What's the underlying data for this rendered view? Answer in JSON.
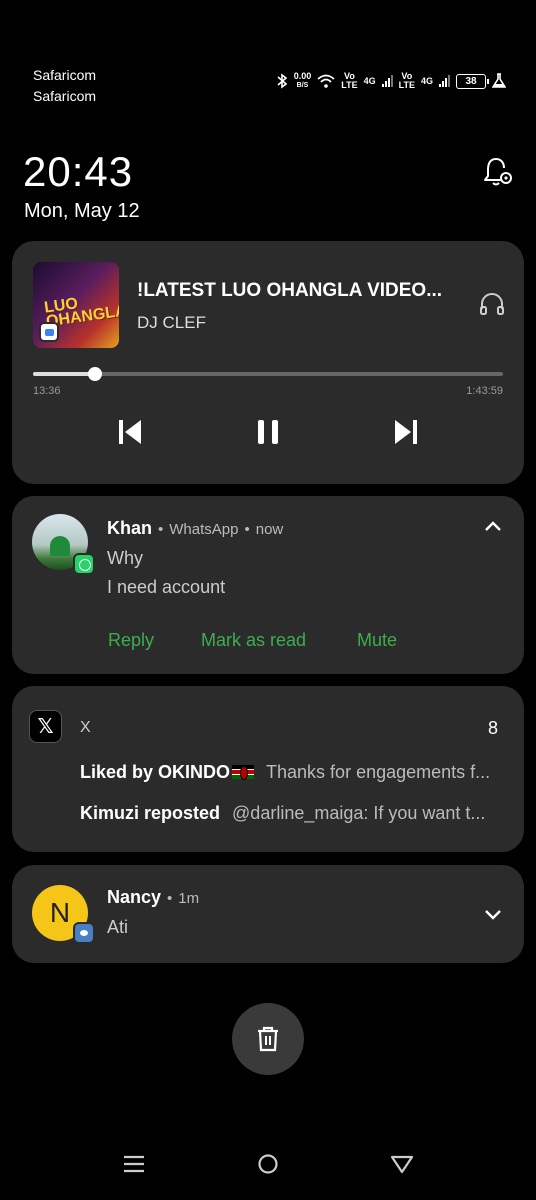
{
  "status_bar": {
    "carrier_1": "Safaricom",
    "carrier_2": "Safaricom",
    "net_speed_value": "0.00",
    "net_speed_unit": "B/S",
    "volte_1": "Vo LTE",
    "net_1": "4G",
    "volte_2": "Vo LTE",
    "net_2": "4G",
    "battery": "38",
    "icons": [
      "bluetooth-icon",
      "wifi-icon",
      "signal-icon",
      "battery-icon",
      "flask-icon"
    ]
  },
  "lock": {
    "time": "20:43",
    "date": "Mon, May 12"
  },
  "media": {
    "title": "!LATEST LUO OHANGLA VIDEO...",
    "artist": "DJ CLEF",
    "album_text_1": "LUO",
    "album_text_2": "OHANGLA",
    "elapsed": "13:36",
    "total": "1:43:59",
    "progress": 0.131
  },
  "whatsapp": {
    "sender": "Khan",
    "app": "WhatsApp",
    "when": "now",
    "line1": "Why",
    "line2": "I need account",
    "actions": [
      "Reply",
      "Mark as read",
      "Mute"
    ],
    "accent": "#3cae4e"
  },
  "x": {
    "app": "X",
    "count": "8",
    "row1_bold": "Liked by OKINDO",
    "row1_msg": "Thanks for engagements f...",
    "row2_bold": "Kimuzi reposted",
    "row2_msg": "@darline_maiga: If you want t..."
  },
  "nancy": {
    "initial": "N",
    "sender": "Nancy",
    "when": "1m",
    "body": "Ati"
  },
  "colors": {
    "card_bg": "#2b2b2b",
    "page_bg": "#000000",
    "avatar_yellow": "#f5c518"
  }
}
